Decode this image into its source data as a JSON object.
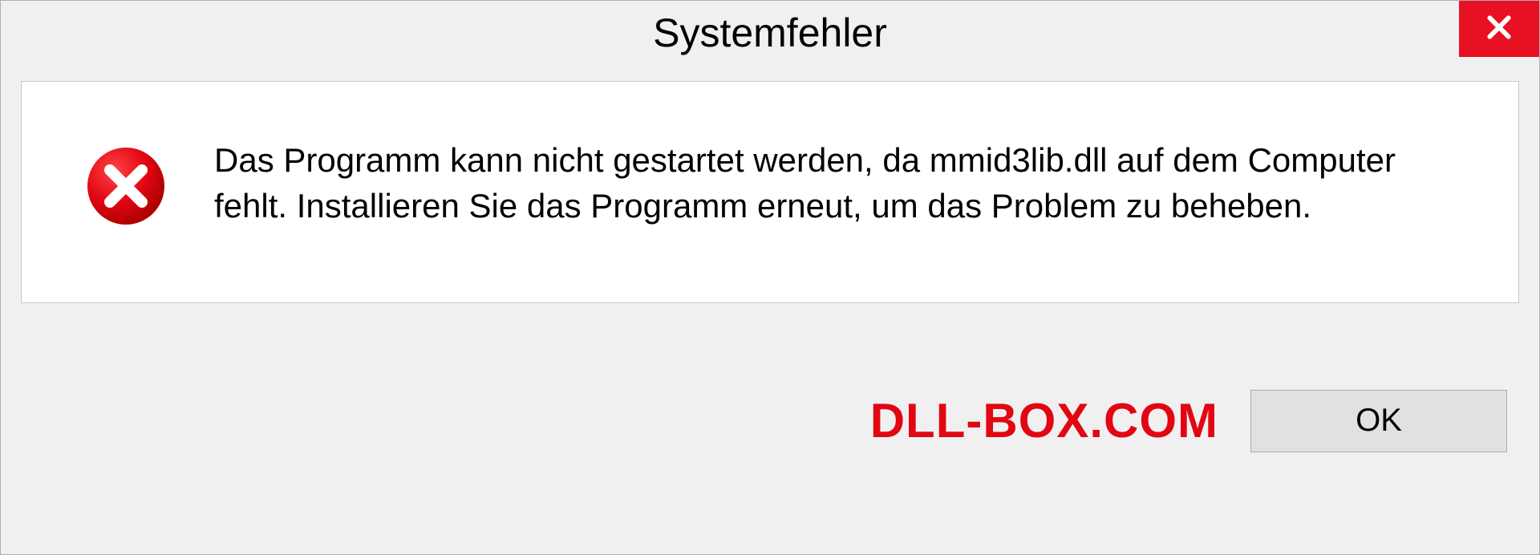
{
  "dialog": {
    "title": "Systemfehler",
    "message": "Das Programm kann nicht gestartet werden, da mmid3lib.dll auf dem Computer fehlt. Installieren Sie das Programm erneut, um das Problem zu beheben.",
    "ok_label": "OK"
  },
  "watermark": "DLL-BOX.COM",
  "colors": {
    "close_bg": "#e81123",
    "error_icon": "#e20613",
    "watermark": "#e20613"
  }
}
